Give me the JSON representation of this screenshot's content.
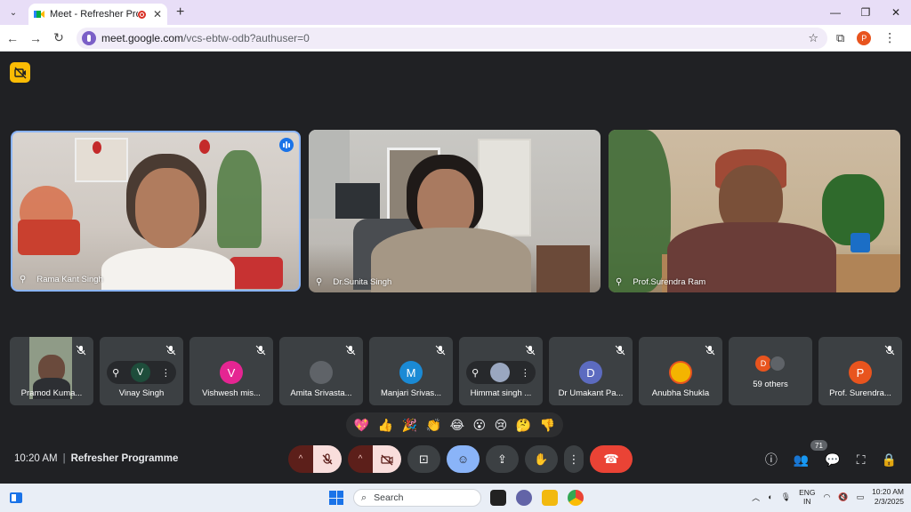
{
  "browser": {
    "tab_title": "Meet - Refresher Programme",
    "url_host": "meet.google.com",
    "url_path": "/vcs-ebtw-odb?authuser=0",
    "profile_initial": "P"
  },
  "featured": [
    {
      "name": "Rama Kant Singh",
      "speaking": true
    },
    {
      "name": "Dr.Sunita Singh",
      "speaking": false
    },
    {
      "name": "Prof.Surendra Ram",
      "speaking": false
    }
  ],
  "participants": [
    {
      "name": "Pramod Kuma...",
      "initial": "",
      "color": "#3c4043"
    },
    {
      "name": "Vinay Singh",
      "initial": "V",
      "color": "#1e4d3b"
    },
    {
      "name": "Vishwesh mis...",
      "initial": "V",
      "color": "#e52592"
    },
    {
      "name": "Amita Srivasta...",
      "initial": "",
      "color": "#5f6368"
    },
    {
      "name": "Manjari Srivas...",
      "initial": "M",
      "color": "#1a8ad5"
    },
    {
      "name": "Himmat singh ...",
      "initial": "",
      "color": "#3c4043"
    },
    {
      "name": "Dr Umakant Pa...",
      "initial": "D",
      "color": "#5c6bc0"
    },
    {
      "name": "Anubha Shukla",
      "initial": "",
      "color": "#f4b400"
    },
    {
      "name": "59 others",
      "initial": "D",
      "color": "#e8541e"
    },
    {
      "name": "Prof. Surendra...",
      "initial": "P",
      "color": "#e8541e"
    }
  ],
  "reactions": [
    "💖",
    "👍",
    "🎉",
    "👏",
    "😂",
    "😮",
    "😢",
    "🤔",
    "👎"
  ],
  "meeting": {
    "time": "10:20 AM",
    "name": "Refresher Programme",
    "people_count": "71"
  },
  "taskbar": {
    "search_placeholder": "Search",
    "lang_line1": "ENG",
    "lang_line2": "IN",
    "time": "10:20 AM",
    "date": "2/3/2025"
  },
  "colors": {
    "accent": "#8ab4f8",
    "end_call": "#ea4335",
    "background": "#202124"
  }
}
